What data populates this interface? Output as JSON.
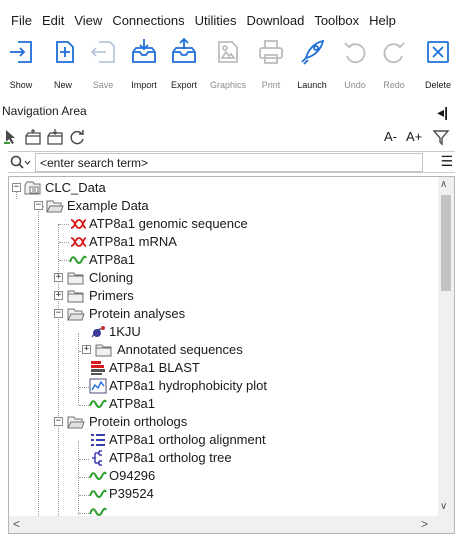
{
  "menu": [
    "File",
    "Edit",
    "View",
    "Connections",
    "Utilities",
    "Download",
    "Toolbox",
    "Help"
  ],
  "toolbar": [
    {
      "label": "Show",
      "icon": "show-icon",
      "enabled": true
    },
    {
      "label": "New",
      "icon": "new-icon",
      "enabled": true
    },
    {
      "label": "Save",
      "icon": "save-icon",
      "enabled": false
    },
    {
      "label": "Import",
      "icon": "import-icon",
      "enabled": true
    },
    {
      "label": "Export",
      "icon": "export-icon",
      "enabled": true
    },
    {
      "label": "Graphics",
      "icon": "graphics-icon",
      "enabled": false
    },
    {
      "label": "Print",
      "icon": "print-icon",
      "enabled": false
    },
    {
      "label": "Launch",
      "icon": "launch-icon",
      "enabled": true
    },
    {
      "label": "Undo",
      "icon": "undo-icon",
      "enabled": false
    },
    {
      "label": "Redo",
      "icon": "redo-icon",
      "enabled": false
    },
    {
      "label": "Delete",
      "icon": "delete-icon",
      "enabled": true
    }
  ],
  "nav": {
    "title": "Navigation Area",
    "pin": "◂|",
    "zoom_out": "A-",
    "zoom_in": "A+"
  },
  "search": {
    "value": "<enter search term>",
    "placeholder": "<enter search term>"
  },
  "tree": {
    "root": "CLC_Data",
    "example_data": "Example Data",
    "items": {
      "genomic": "ATP8a1 genomic sequence",
      "mrna": "ATP8a1 mRNA",
      "protein": "ATP8a1",
      "cloning": "Cloning",
      "primers": "Primers",
      "protein_analyses": "Protein analyses",
      "structure": "1KJU",
      "annotated": "Annotated sequences",
      "blast": "ATP8a1 BLAST",
      "hydro": "ATP8a1 hydrophobicity plot",
      "protein2": "ATP8a1",
      "orthologs": "Protein orthologs",
      "alignment": "ATP8a1 ortholog alignment",
      "ortho_tree": "ATP8a1 ortholog tree",
      "o94296": "O94296",
      "p39524": "P39524"
    }
  },
  "colors": {
    "accent_blue": "#1e6fd9",
    "dna_red": "#d81b1b",
    "protein_green": "#2e9e2e",
    "folder_fill": "#f1f1f1",
    "disabled_text": "#8c8c8c"
  }
}
